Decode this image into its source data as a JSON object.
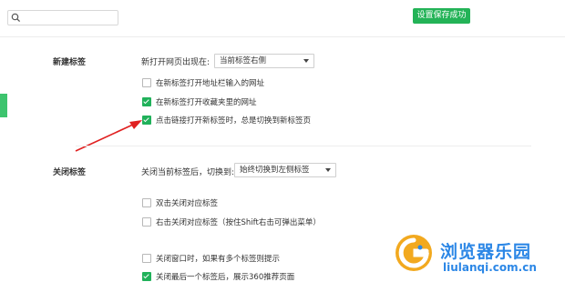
{
  "search": {
    "placeholder": "",
    "icon": "search-icon"
  },
  "toast": {
    "label": "设置保存成功",
    "color": "#23b357"
  },
  "sections": {
    "new_tab": {
      "title": "新建标签",
      "open_position_label": "新打开网页出现在:",
      "open_position_value": "当前标签右侧",
      "options": [
        {
          "label": "在新标签打开地址栏输入的网址",
          "checked": false
        },
        {
          "label": "在新标签打开收藏夹里的网址",
          "checked": true
        },
        {
          "label": "点击链接打开新标签时，总是切换到新标签页",
          "checked": true
        }
      ]
    },
    "close_tab": {
      "title": "关闭标签",
      "after_close_label": "关闭当前标签后，切换到:",
      "after_close_value": "始终切换到左侧标签",
      "options": [
        {
          "label": "双击关闭对应标签",
          "checked": false
        },
        {
          "label": "右击关闭对应标签（按住Shift右击可弹出菜单）",
          "checked": false
        },
        {
          "label": "关闭窗口时，如果有多个标签则提示",
          "checked": false
        },
        {
          "label": "关闭最后一个标签后，展示360推荐页面",
          "checked": true
        }
      ]
    }
  },
  "annotation": {
    "arrow_color": "#e02020"
  },
  "watermark": {
    "name": "浏览器乐园",
    "url": "liulanqi.com.cn",
    "color": "#2c87e6"
  }
}
